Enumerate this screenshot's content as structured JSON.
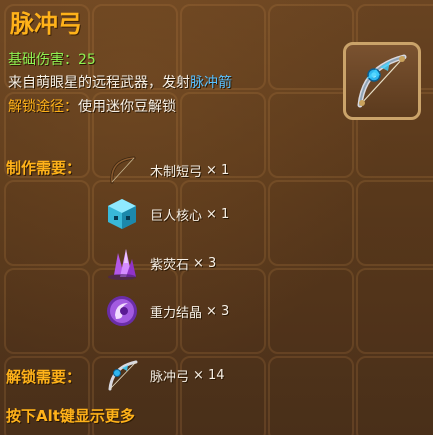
{
  "title": "脉冲弓",
  "base_damage": "基础伤害：25",
  "description": {
    "prefix": "来自萌眼星的远程武器，发射",
    "highlight": "脉冲箭"
  },
  "unlock_path": {
    "label": "解锁途径：",
    "value": "使用迷你豆解锁"
  },
  "crafting": {
    "label": "制作需要：",
    "materials": [
      {
        "name": "木制短弓",
        "count": "× 1",
        "icon": "wooden-bow-icon"
      },
      {
        "name": "巨人核心",
        "count": "× 1",
        "icon": "giant-core-icon"
      },
      {
        "name": "紫荧石",
        "count": "× 3",
        "icon": "purple-crystal-icon"
      },
      {
        "name": "重力结晶",
        "count": "× 3",
        "icon": "gravity-crystal-icon"
      }
    ]
  },
  "unlock_requirement": {
    "label": "解锁需要：",
    "item": {
      "name": "脉冲弓",
      "count": "× 14",
      "icon": "pulse-bow-icon"
    }
  },
  "footer_hint": "按下Alt键显示更多",
  "colors": {
    "title": "#ffb21a",
    "stat": "#8ff252",
    "highlight": "#58c0ff",
    "text": "#f7f0e6",
    "background": "#5a3a1c"
  }
}
